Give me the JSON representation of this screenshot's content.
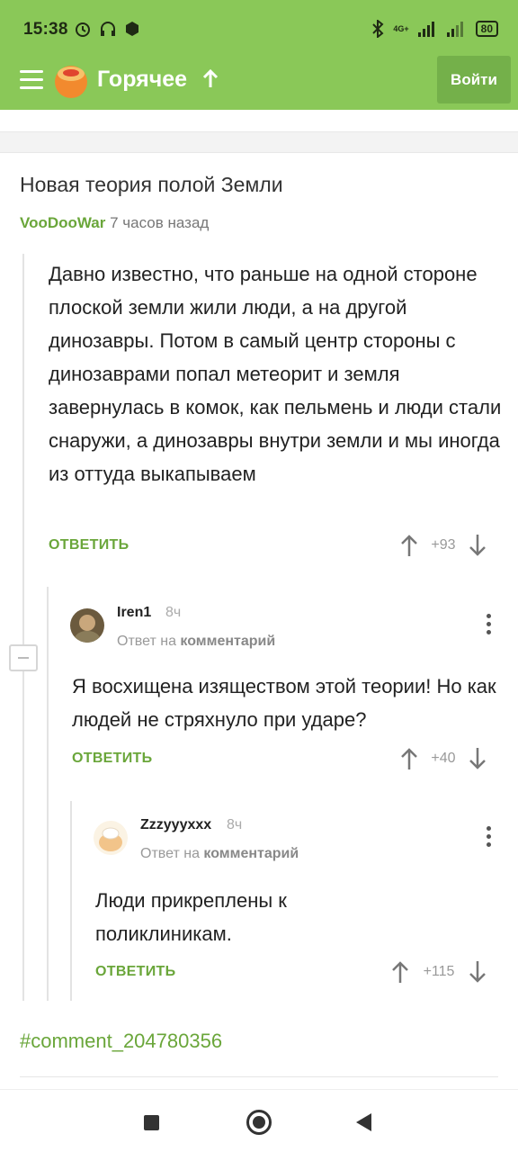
{
  "status_bar": {
    "time": "15:38",
    "network": "4G+",
    "battery": "80"
  },
  "header": {
    "title": "Горячее",
    "login_label": "Войти"
  },
  "post": {
    "title": "Новая теория полой Земли",
    "author": "VooDooWar",
    "time": "7 часов назад"
  },
  "comments": [
    {
      "text": "Давно известно, что раньше на одной стороне плоской земли жили люди, а на другой динозавры. Потом в самый центр стороны с динозаврами попал метеорит и земля завернулась в комок, как пельмень и люди стали снаружи, а динозавры внутри земли и мы иногда из оттуда выкапываем",
      "reply_label": "ОТВЕТИТЬ",
      "votes": "+93"
    },
    {
      "username": "Iren1",
      "time": "8ч",
      "reply_to_prefix": "Ответ на",
      "reply_to_target": "комментарий",
      "text": "Я восхищена изяществом этой теории! Но как людей не стряхнуло при ударе?",
      "reply_label": "ОТВЕТИТЬ",
      "votes": "+40"
    },
    {
      "username": "Zzzyyyxxx",
      "time": "8ч",
      "reply_to_prefix": "Ответ на",
      "reply_to_target": "комментарий",
      "text": "Люди прикреплены к поликлиникам.",
      "reply_label": "ОТВЕТИТЬ",
      "votes": "+115"
    }
  ],
  "hashtag": "#comment_204780356",
  "colors": {
    "brand_green": "#8ac858",
    "link_green": "#6aa63a",
    "button_green": "#74b04a"
  },
  "icons": [
    "menu-icon",
    "pikabu-logo-icon",
    "arrow-up-icon",
    "upvote-icon",
    "downvote-icon",
    "kebab-menu-icon",
    "collapse-icon"
  ]
}
